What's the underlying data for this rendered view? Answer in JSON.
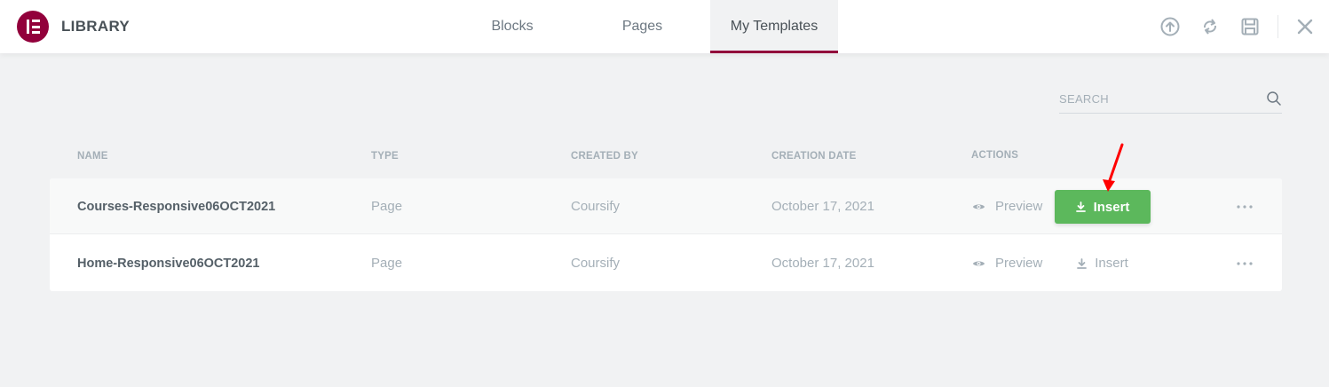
{
  "header": {
    "title": "LIBRARY",
    "tabs": [
      {
        "label": "Blocks"
      },
      {
        "label": "Pages"
      },
      {
        "label": "My Templates"
      }
    ],
    "active_tab": "My Templates",
    "icons": [
      "upload-icon",
      "sync-icon",
      "save-icon",
      "close-icon"
    ],
    "accent_color": "#92003b"
  },
  "search": {
    "placeholder": "SEARCH"
  },
  "table": {
    "columns": [
      "NAME",
      "TYPE",
      "CREATED BY",
      "CREATION DATE",
      "ACTIONS"
    ],
    "rows": [
      {
        "name": "Courses-Responsive06OCT2021",
        "type": "Page",
        "created_by": "Coursify",
        "creation_date": "October 17, 2021",
        "preview_label": "Preview",
        "insert_label": "Insert"
      },
      {
        "name": "Home-Responsive06OCT2021",
        "type": "Page",
        "created_by": "Coursify",
        "creation_date": "October 17, 2021",
        "preview_label": "Preview",
        "insert_label": "Insert"
      }
    ],
    "insert_button_color": "#5cb85c"
  },
  "annotation": {
    "arrow_color": "#ff0000"
  }
}
